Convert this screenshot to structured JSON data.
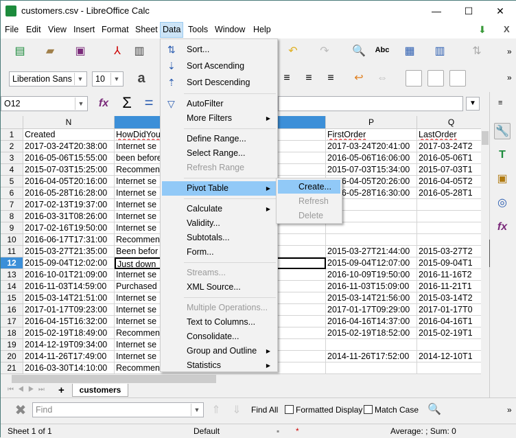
{
  "window": {
    "title": "customers.csv - LibreOffice Calc",
    "minimize": "—",
    "maximize": "☐",
    "close": "✕"
  },
  "menubar": {
    "items": [
      "File",
      "Edit",
      "View",
      "Insert",
      "Format",
      "Sheet",
      "Data",
      "Tools",
      "Window",
      "Help"
    ],
    "close_doc": "X"
  },
  "toolbar": {
    "font_name": "Liberation Sans",
    "font_size": "10",
    "more": "»"
  },
  "formula_bar": {
    "name_box": "O12",
    "value": ""
  },
  "columns": [
    "N",
    "O",
    "P",
    "Q"
  ],
  "rows": [
    {
      "n": "1",
      "N": "Created",
      "O": "HowDidYou",
      "P": "FirstOrder",
      "Q": "LastOrder"
    },
    {
      "n": "2",
      "N": "2017-03-24T20:38:00",
      "O": "Internet se",
      "P": "2017-03-24T20:41:00",
      "Q": "2017-03-24T2"
    },
    {
      "n": "3",
      "N": "2016-05-06T15:55:00",
      "O": "been before",
      "P": "2016-05-06T16:06:00",
      "Q": "2016-05-06T1"
    },
    {
      "n": "4",
      "N": "2015-07-03T15:25:00",
      "O": "Recommen",
      "P": "2015-07-03T15:34:00",
      "Q": "2015-07-03T1"
    },
    {
      "n": "5",
      "N": "2016-04-05T20:16:00",
      "O": "Internet se",
      "P": "2016-04-05T20:26:00",
      "Q": "2016-04-05T2"
    },
    {
      "n": "6",
      "N": "2016-05-28T16:28:00",
      "O": "Internet se",
      "P": "2016-05-28T16:30:00",
      "Q": "2016-05-28T1"
    },
    {
      "n": "7",
      "N": "2017-02-13T19:37:00",
      "O": "Internet se",
      "P": "",
      "Q": ""
    },
    {
      "n": "8",
      "N": "2016-03-31T08:26:00",
      "O": "Internet se",
      "P": "",
      "Q": ""
    },
    {
      "n": "9",
      "N": "2017-02-16T19:50:00",
      "O": "Internet se",
      "P": "",
      "Q": ""
    },
    {
      "n": "10",
      "N": "2016-06-17T17:31:00",
      "O": "Recommen",
      "P": "",
      "Q": ""
    },
    {
      "n": "11",
      "N": "2015-03-27T21:35:00",
      "O": "Been befor",
      "P": "2015-03-27T21:44:00",
      "Q": "2015-03-27T2"
    },
    {
      "n": "12",
      "N": "2015-09-04T12:02:00",
      "O": "Just down",
      "P": "2015-09-04T12:07:00",
      "Q": "2015-09-04T1"
    },
    {
      "n": "13",
      "N": "2016-10-01T21:09:00",
      "O": "Internet se",
      "P": "2016-10-09T19:50:00",
      "Q": "2016-11-16T2"
    },
    {
      "n": "14",
      "N": "2016-11-03T14:59:00",
      "O": "Purchased",
      "P": "2016-11-03T15:09:00",
      "Q": "2016-11-21T1"
    },
    {
      "n": "15",
      "N": "2015-03-14T21:51:00",
      "O": "Internet se",
      "P": "2015-03-14T21:56:00",
      "Q": "2015-03-14T2"
    },
    {
      "n": "16",
      "N": "2017-01-17T09:23:00",
      "O": "Internet se",
      "P": "2017-01-17T09:29:00",
      "Q": "2017-01-17T0"
    },
    {
      "n": "17",
      "N": "2016-04-15T16:32:00",
      "O": "Internet se",
      "P": "2016-04-16T14:37:00",
      "Q": "2016-04-16T1"
    },
    {
      "n": "18",
      "N": "2015-02-19T18:49:00",
      "O": "Recommen",
      "P": "2015-02-19T18:52:00",
      "Q": "2015-02-19T1"
    },
    {
      "n": "19",
      "N": "2014-12-19T09:34:00",
      "O": "Internet se",
      "P": "",
      "Q": ""
    },
    {
      "n": "20",
      "N": "2014-11-26T17:49:00",
      "O": "Internet se",
      "P": "2014-11-26T17:52:00",
      "Q": "2014-12-10T1"
    },
    {
      "n": "21",
      "N": "2016-03-30T14:10:00",
      "O": "Recommendation",
      "P": "",
      "Q": ""
    }
  ],
  "data_menu": [
    {
      "label": "Sort...",
      "icon": "sort-icon"
    },
    {
      "label": "Sort Ascending",
      "icon": "sort-ascending-icon"
    },
    {
      "label": "Sort Descending",
      "icon": "sort-descending-icon"
    },
    {
      "sep": true
    },
    {
      "label": "AutoFilter",
      "icon": "autofilter-icon"
    },
    {
      "label": "More Filters",
      "submenu": true
    },
    {
      "sep": true
    },
    {
      "label": "Define Range..."
    },
    {
      "label": "Select Range..."
    },
    {
      "label": "Refresh Range",
      "disabled": true
    },
    {
      "sep": true
    },
    {
      "label": "Pivot Table",
      "submenu": true,
      "highlighted": true
    },
    {
      "sep": true
    },
    {
      "label": "Calculate",
      "submenu": true
    },
    {
      "label": "Validity..."
    },
    {
      "label": "Subtotals..."
    },
    {
      "label": "Form..."
    },
    {
      "sep": true
    },
    {
      "label": "Streams...",
      "disabled": true
    },
    {
      "label": "XML Source..."
    },
    {
      "sep": true
    },
    {
      "label": "Multiple Operations...",
      "disabled": true
    },
    {
      "label": "Text to Columns..."
    },
    {
      "label": "Consolidate..."
    },
    {
      "label": "Group and Outline",
      "submenu": true
    },
    {
      "label": "Statistics",
      "submenu": true
    }
  ],
  "pivot_submenu": [
    {
      "label": "Create...",
      "highlighted": true
    },
    {
      "label": "Refresh",
      "disabled": true
    },
    {
      "label": "Delete",
      "disabled": true
    }
  ],
  "sheet_tabs": {
    "add": "+",
    "tabs": [
      "customers"
    ]
  },
  "find_bar": {
    "placeholder": "Find",
    "find_all": "Find All",
    "formatted_display": "Formatted Display",
    "match_case": "Match Case",
    "more": "»"
  },
  "status": {
    "sheet": "Sheet 1 of 1",
    "style": "Default",
    "summary": "Average: ; Sum: 0"
  },
  "colors": {
    "accent": "#0078d7",
    "menu_highlight": "#91c9f7",
    "header_selected": "#3c8fd8"
  }
}
